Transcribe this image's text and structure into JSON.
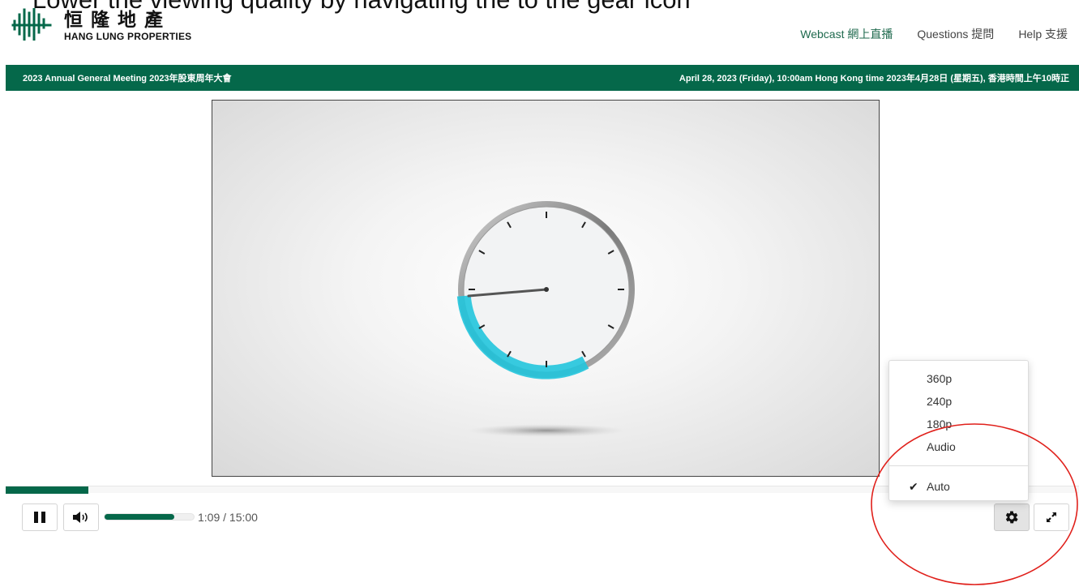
{
  "instruction_caption": "Lower the viewing quality by navigating the to the gear icon",
  "logo": {
    "chinese_name": "恒隆地產",
    "english_name": "HANG LUNG PROPERTIES"
  },
  "nav": {
    "webcast": "Webcast 網上直播",
    "questions": "Questions 提問",
    "help": "Help 支援"
  },
  "banner": {
    "event_title": "2023 Annual General Meeting 2023年股東周年大會",
    "event_time": "April 28, 2023 (Friday), 10:00am Hong Kong time 2023年4月28日 (星期五), 香港時間上午10時正"
  },
  "player": {
    "progress_fraction": 0.077,
    "volume_fraction": 0.78,
    "time_display": "1:09 / 15:00",
    "icons": {
      "play_pause": "pause-icon",
      "volume": "volume-icon",
      "settings": "gear-icon",
      "fullscreen": "fullscreen-icon"
    }
  },
  "quality_menu": {
    "options": [
      "360p",
      "240p",
      "180p",
      "Audio"
    ],
    "auto_label": "Auto",
    "selected": "Auto"
  },
  "colors": {
    "brand_green": "#05684a",
    "annotation_red": "#e0201b",
    "gauge_cyan": "#22c5dd"
  }
}
